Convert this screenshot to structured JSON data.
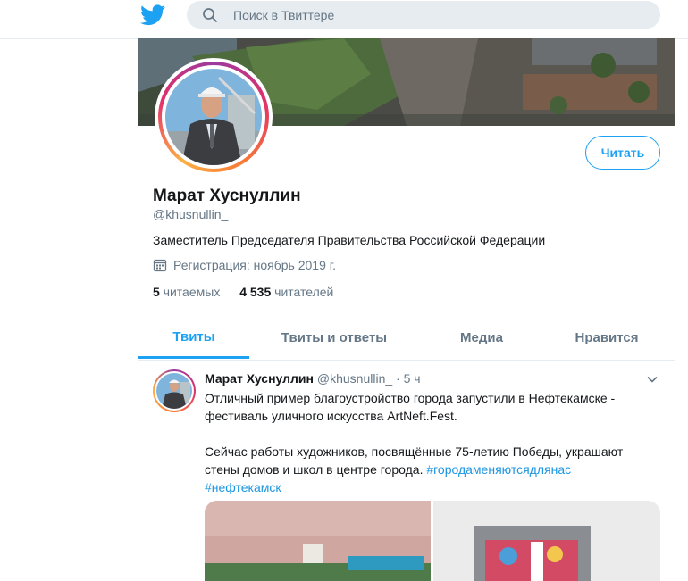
{
  "header": {
    "logo": "twitter-bird-icon",
    "search_placeholder": "Поиск в Твиттере",
    "brand_color": "#1da1f2"
  },
  "profile": {
    "name": "Марат Хуснуллин",
    "handle": "@khusnullin_",
    "bio": "Заместитель Председателя Правительства Российской Федерации",
    "joined": "Регистрация: ноябрь 2019 г.",
    "following_count": "5",
    "following_label": "читаемых",
    "followers_count": "4 535",
    "followers_label": "читателей",
    "follow_button": "Читать"
  },
  "tabs": [
    {
      "label": "Твиты",
      "active": true
    },
    {
      "label": "Твиты и ответы",
      "active": false
    },
    {
      "label": "Медиа",
      "active": false
    },
    {
      "label": "Нравится",
      "active": false
    }
  ],
  "tweet": {
    "author_name": "Марат Хуснуллин",
    "author_handle": "@khusnullin_",
    "separator": "·",
    "time": "5 ч",
    "text_line1": "Отличный пример благоустройство города запустили в Нефтекамске -",
    "text_line2": "фестиваль уличного искусства ArtNeft.Fest.",
    "text_line3": "Сейчас работы художников, посвящённые 75-летию Победы, украшают",
    "text_line4": "стены домов и школ в центре города.",
    "hashtag1": "#городаменяютсядлянас",
    "hashtag2": "#нефтекамск"
  }
}
